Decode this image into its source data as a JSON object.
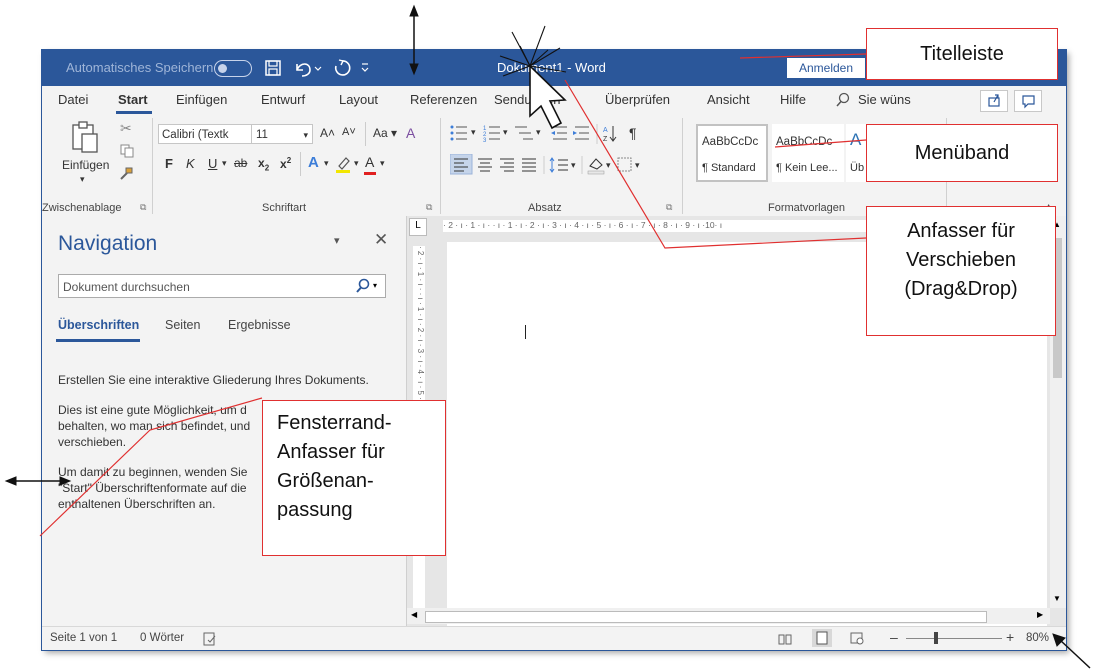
{
  "titlebar": {
    "autosave_label": "Automatisches Speichern",
    "doc_title": "Dokument1  -  Word",
    "signin_label": "Anmelden"
  },
  "menu": {
    "tabs": [
      "Datei",
      "Start",
      "Einfügen",
      "Entwurf",
      "Layout",
      "Referenzen",
      "Sendungen",
      "Überprüfen",
      "Ansicht",
      "Hilfe"
    ],
    "tell_me": "Sie wüns"
  },
  "ribbon": {
    "paste_label": "Einfügen",
    "clipboard_group": "Zwischenablage",
    "font_name": "Calibri (Textk",
    "font_size": "11",
    "font_group": "Schriftart",
    "paragraph_group": "Absatz",
    "styles_group": "Formatvorlagen",
    "styles": [
      {
        "preview": "AaBbCcDc",
        "name": "¶ Standard"
      },
      {
        "preview": "AaBbCcDc",
        "name": "¶ Kein Lee..."
      },
      {
        "preview": "A",
        "name": "Üb"
      }
    ]
  },
  "nav": {
    "title": "Navigation",
    "search_placeholder": "Dokument durchsuchen",
    "tabs": [
      "Überschriften",
      "Seiten",
      "Ergebnisse"
    ],
    "para1": "Erstellen Sie eine interaktive Gliederung Ihres Dokuments.",
    "para2": "Dies ist eine gute Möglichkeit, um d behalten, wo man sich befindet, und verschieben.",
    "para3": "Um damit zu beginnen, wenden Sie \"Start\" Überschriftenformate auf die enthaltenen Überschriften an."
  },
  "ruler": {
    "h_ticks": "· 2 · ı · 1 · ı ·    · ı · 1 · ı · 2 · ı · 3 · ı · 4 · ı · 5 · ı · 6 · ı · 7 · ı · 8 · ı · 9 · ı ·10· ı",
    "v_ticks": "· 2 · ı · 1 · ı ·   · ı · 1 · ı · 2 · ı · 3 · ı · 4 · ı · 5 · ı · 6 · ı · 7 · ı · 8 · ı · 9"
  },
  "status": {
    "page": "Seite 1 von 1",
    "words": "0 Wörter",
    "zoom": "80%"
  },
  "callouts": {
    "title": "Titelleiste",
    "ribbon": "Menüband",
    "drag_line1": "Anfasser für",
    "drag_line2": "Verschieben",
    "drag_line3": "(Drag&Drop)",
    "resize_line1": "Fensterrand-",
    "resize_line2": "Anfasser für",
    "resize_line3": "Größenan-",
    "resize_line4": "passung"
  },
  "colors": {
    "word_blue": "#2b579a",
    "callout_red": "#e03030"
  }
}
